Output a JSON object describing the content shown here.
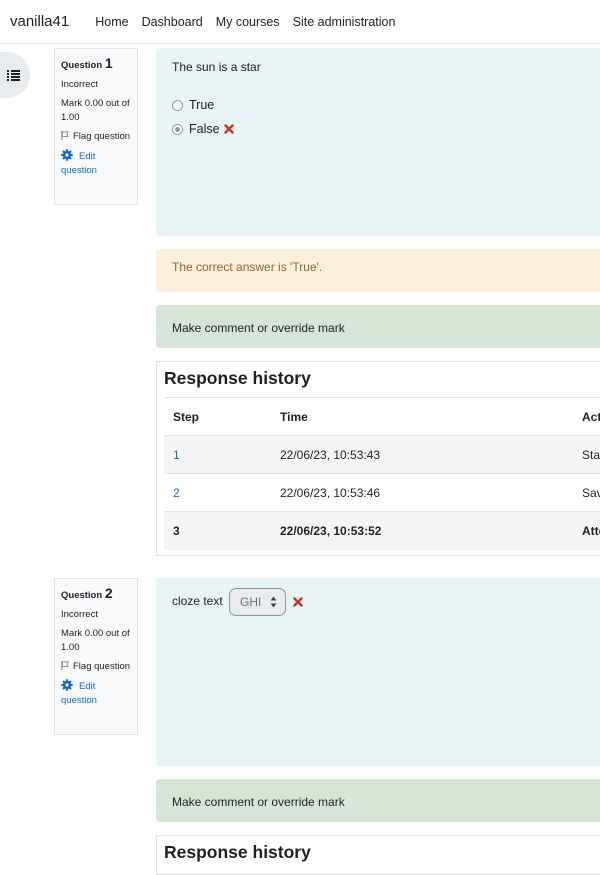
{
  "navbar": {
    "brand": "vanilla41",
    "links": [
      "Home",
      "Dashboard",
      "My courses",
      "Site administration"
    ]
  },
  "questions": [
    {
      "label": "Question",
      "number": "1",
      "state": "Incorrect",
      "mark": "Mark 0.00 out of 1.00",
      "flag": "Flag question",
      "edit": "Edit question",
      "text": "The sun is a star",
      "options": [
        {
          "label": "True",
          "checked": false
        },
        {
          "label": "False",
          "checked": true
        }
      ],
      "feedback": "The correct answer is 'True'.",
      "comment": "Make comment or override mark",
      "history": {
        "title": "Response history",
        "headers": [
          "Step",
          "Time",
          "Act"
        ],
        "rows": [
          [
            "1",
            "22/06/23, 10:53:43",
            "Sta"
          ],
          [
            "2",
            "22/06/23, 10:53:46",
            "Sav"
          ],
          [
            "3",
            "22/06/23, 10:53:52",
            "Atte"
          ]
        ]
      }
    },
    {
      "label": "Question",
      "number": "2",
      "state": "Incorrect",
      "mark": "Mark 0.00 out of 1.00",
      "flag": "Flag question",
      "edit": "Edit question",
      "text": "cloze text",
      "select_value": "GHI",
      "comment": "Make comment or override mark",
      "history_title": "Response history"
    }
  ],
  "colors": {
    "link": "#0f6cbf",
    "incorrect": "#ca3120",
    "formulation_bg": "#e7f3f5",
    "outcome_bg": "#fcefdc",
    "comment_bg": "#d7e4d7"
  }
}
